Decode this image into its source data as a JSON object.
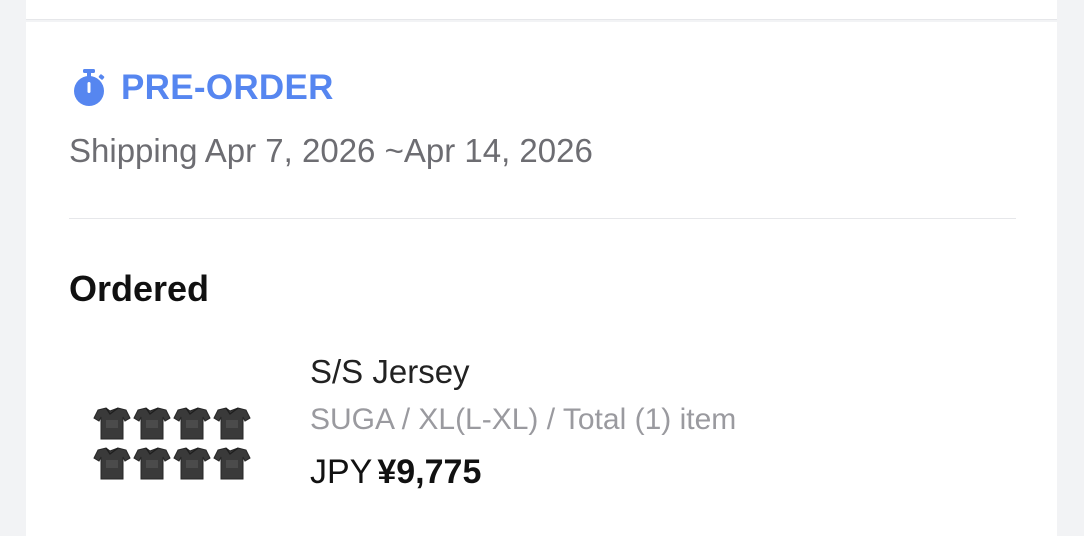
{
  "preorder": {
    "label": "PRE-ORDER",
    "icon": "stopwatch-icon",
    "color": "#5686f0"
  },
  "shipping": {
    "text": "Shipping Apr 7, 2026 ~Apr 14, 2026"
  },
  "ordered": {
    "title": "Ordered",
    "items": [
      {
        "name": "S/S Jersey",
        "options": "SUGA / XL(L-XL) / Total (1) item",
        "currency": "JPY",
        "price": "¥9,775",
        "image": "jersey-set-thumbnail"
      }
    ]
  }
}
